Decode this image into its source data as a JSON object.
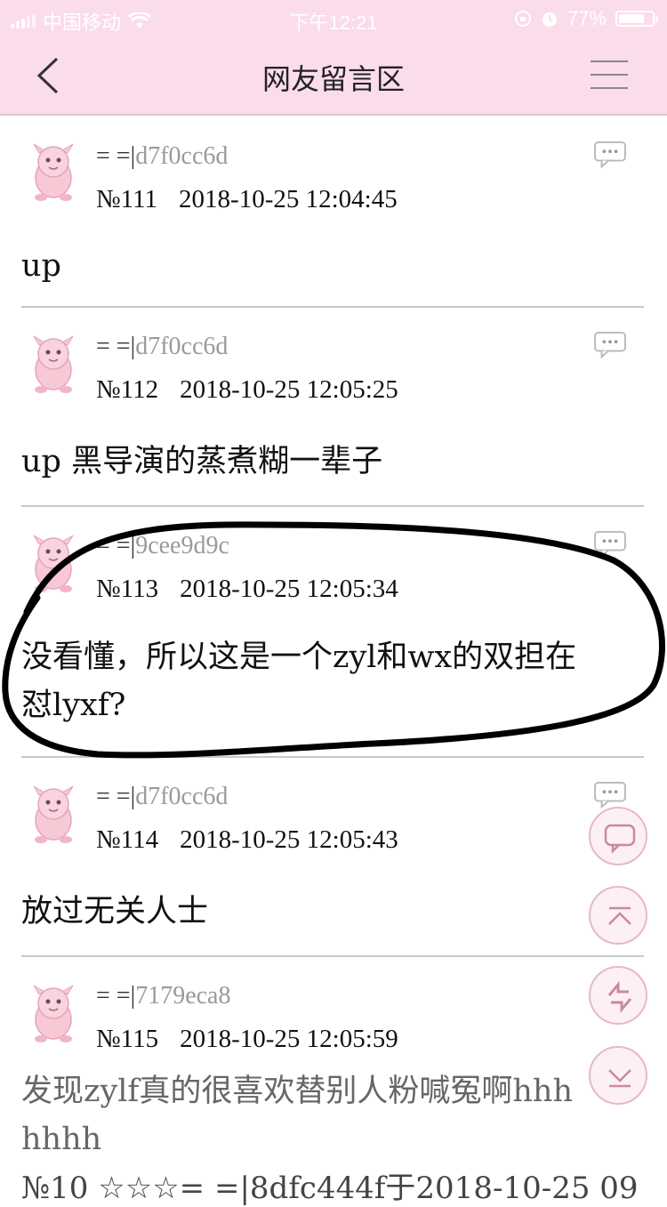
{
  "status_bar": {
    "carrier": "中国移动",
    "time": "下午12:21",
    "battery": "77%",
    "battery_level": 0.77
  },
  "header": {
    "title": "网友留言区"
  },
  "posts": [
    {
      "user_prefix": "= =|",
      "user_id": "d7f0cc6d",
      "number": "№111",
      "datetime": "2018-10-25 12:04:45",
      "content": "up"
    },
    {
      "user_prefix": "= =|",
      "user_id": "d7f0cc6d",
      "number": "№112",
      "datetime": "2018-10-25 12:05:25",
      "content": "up 黑导演的蒸煮糊一辈子"
    },
    {
      "user_prefix": "= =|",
      "user_id": "9cee9d9c",
      "number": "№113",
      "datetime": "2018-10-25 12:05:34",
      "content_line1": "没看懂，所以这是一个zyl和wx的双担在",
      "content_line2": "怼lyxf?"
    },
    {
      "user_prefix": "= =|",
      "user_id": "d7f0cc6d",
      "number": "№114",
      "datetime": "2018-10-25 12:05:43",
      "content": "放过无关人士"
    },
    {
      "user_prefix": "= =|",
      "user_id": "7179eca8",
      "number": "№115",
      "datetime": "2018-10-25 12:05:59",
      "content_line1": "发现zylf真的很喜欢替别人粉喊冤啊hhh",
      "content_line2": "hhhh"
    }
  ],
  "next_item_preview": "№10 ☆☆☆= =|8dfc444f于2018-10-25 09",
  "icons": {
    "back": "chevron-left-icon",
    "menu": "hamburger-menu-icon",
    "reply": "speech-bubble-icon",
    "comment": "comment-icon",
    "to_top": "arrow-up-icon",
    "refresh": "refresh-icon",
    "to_bottom": "arrow-down-icon",
    "avatar": "pink-creature-avatar-icon"
  },
  "colors": {
    "header_bg": "#fbdcea",
    "accent_pink": "#e6b8c9",
    "divider": "#c9c9c9"
  }
}
